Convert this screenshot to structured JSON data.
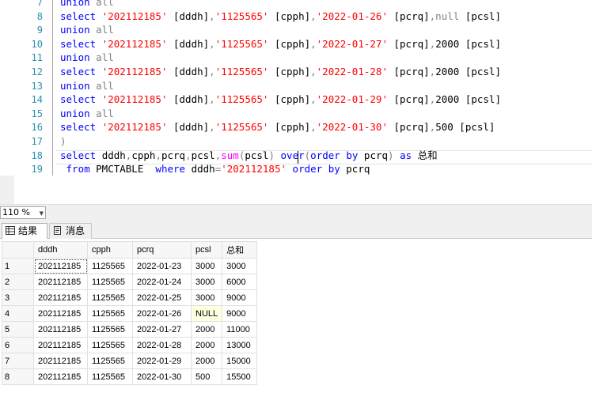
{
  "editor": {
    "lines": [
      {
        "num": "7",
        "tokens": [
          {
            "t": "union",
            "c": "kw"
          },
          {
            "t": " all",
            "c": "gr"
          }
        ]
      },
      {
        "num": "8",
        "tokens": [
          {
            "t": "select ",
            "c": "kw"
          },
          {
            "t": "'202112185'",
            "c": "str"
          },
          {
            "t": " [dddh]",
            "c": "tx"
          },
          {
            "t": ",",
            "c": "gr"
          },
          {
            "t": "'1125565'",
            "c": "str"
          },
          {
            "t": " [cpph]",
            "c": "tx"
          },
          {
            "t": ",",
            "c": "gr"
          },
          {
            "t": "'2022-01-26'",
            "c": "str"
          },
          {
            "t": " [pcrq]",
            "c": "tx"
          },
          {
            "t": ",null",
            "c": "gr"
          },
          {
            "t": " [pcsl]",
            "c": "tx"
          }
        ]
      },
      {
        "num": "9",
        "tokens": [
          {
            "t": "union",
            "c": "kw"
          },
          {
            "t": " all",
            "c": "gr"
          }
        ]
      },
      {
        "num": "10",
        "tokens": [
          {
            "t": "select ",
            "c": "kw"
          },
          {
            "t": "'202112185'",
            "c": "str"
          },
          {
            "t": " [dddh]",
            "c": "tx"
          },
          {
            "t": ",",
            "c": "gr"
          },
          {
            "t": "'1125565'",
            "c": "str"
          },
          {
            "t": " [cpph]",
            "c": "tx"
          },
          {
            "t": ",",
            "c": "gr"
          },
          {
            "t": "'2022-01-27'",
            "c": "str"
          },
          {
            "t": " [pcrq]",
            "c": "tx"
          },
          {
            "t": ",",
            "c": "gr"
          },
          {
            "t": "2000",
            "c": "tx"
          },
          {
            "t": " [pcsl]",
            "c": "tx"
          }
        ]
      },
      {
        "num": "11",
        "tokens": [
          {
            "t": "union",
            "c": "kw"
          },
          {
            "t": " all",
            "c": "gr"
          }
        ]
      },
      {
        "num": "12",
        "tokens": [
          {
            "t": "select ",
            "c": "kw"
          },
          {
            "t": "'202112185'",
            "c": "str"
          },
          {
            "t": " [dddh]",
            "c": "tx"
          },
          {
            "t": ",",
            "c": "gr"
          },
          {
            "t": "'1125565'",
            "c": "str"
          },
          {
            "t": " [cpph]",
            "c": "tx"
          },
          {
            "t": ",",
            "c": "gr"
          },
          {
            "t": "'2022-01-28'",
            "c": "str"
          },
          {
            "t": " [pcrq]",
            "c": "tx"
          },
          {
            "t": ",",
            "c": "gr"
          },
          {
            "t": "2000",
            "c": "tx"
          },
          {
            "t": " [pcsl]",
            "c": "tx"
          }
        ]
      },
      {
        "num": "13",
        "tokens": [
          {
            "t": "union",
            "c": "kw"
          },
          {
            "t": " all",
            "c": "gr"
          }
        ]
      },
      {
        "num": "14",
        "tokens": [
          {
            "t": "select ",
            "c": "kw"
          },
          {
            "t": "'202112185'",
            "c": "str"
          },
          {
            "t": " [dddh]",
            "c": "tx"
          },
          {
            "t": ",",
            "c": "gr"
          },
          {
            "t": "'1125565'",
            "c": "str"
          },
          {
            "t": " [cpph]",
            "c": "tx"
          },
          {
            "t": ",",
            "c": "gr"
          },
          {
            "t": "'2022-01-29'",
            "c": "str"
          },
          {
            "t": " [pcrq]",
            "c": "tx"
          },
          {
            "t": ",",
            "c": "gr"
          },
          {
            "t": "2000",
            "c": "tx"
          },
          {
            "t": " [pcsl]",
            "c": "tx"
          }
        ]
      },
      {
        "num": "15",
        "tokens": [
          {
            "t": "union",
            "c": "kw"
          },
          {
            "t": " all",
            "c": "gr"
          }
        ]
      },
      {
        "num": "16",
        "tokens": [
          {
            "t": "select ",
            "c": "kw"
          },
          {
            "t": "'202112185'",
            "c": "str"
          },
          {
            "t": " [dddh]",
            "c": "tx"
          },
          {
            "t": ",",
            "c": "gr"
          },
          {
            "t": "'1125565'",
            "c": "str"
          },
          {
            "t": " [cpph]",
            "c": "tx"
          },
          {
            "t": ",",
            "c": "gr"
          },
          {
            "t": "'2022-01-30'",
            "c": "str"
          },
          {
            "t": " [pcrq]",
            "c": "tx"
          },
          {
            "t": ",",
            "c": "gr"
          },
          {
            "t": "500",
            "c": "tx"
          },
          {
            "t": " [pcsl]",
            "c": "tx"
          }
        ]
      },
      {
        "num": "17",
        "tokens": [
          {
            "t": ")",
            "c": "gr"
          }
        ]
      },
      {
        "num": "18",
        "tokens": [
          {
            "t": "select ",
            "c": "kw"
          },
          {
            "t": "dddh",
            "c": "tx"
          },
          {
            "t": ",",
            "c": "gr"
          },
          {
            "t": "cpph",
            "c": "tx"
          },
          {
            "t": ",",
            "c": "gr"
          },
          {
            "t": "pcrq",
            "c": "tx"
          },
          {
            "t": ",",
            "c": "gr"
          },
          {
            "t": "pcsl",
            "c": "tx"
          },
          {
            "t": ",",
            "c": "gr"
          },
          {
            "t": "sum",
            "c": "fn"
          },
          {
            "t": "(",
            "c": "gr"
          },
          {
            "t": "pcsl",
            "c": "tx"
          },
          {
            "t": ")",
            "c": "gr"
          },
          {
            "t": " over",
            "c": "kw"
          },
          {
            "t": "(",
            "c": "gr"
          },
          {
            "t": "order by",
            "c": "kw"
          },
          {
            "t": " pcrq",
            "c": "tx"
          },
          {
            "t": ")",
            "c": "gr"
          },
          {
            "t": " as ",
            "c": "kw"
          },
          {
            "t": "总和",
            "c": "tx"
          }
        ]
      },
      {
        "num": "19",
        "tokens": [
          {
            "t": " from ",
            "c": "kw"
          },
          {
            "t": "PMCTABLE  ",
            "c": "tx"
          },
          {
            "t": "where ",
            "c": "kw"
          },
          {
            "t": "dddh",
            "c": "tx"
          },
          {
            "t": "=",
            "c": "gr"
          },
          {
            "t": "'202112185'",
            "c": "str"
          },
          {
            "t": " order by ",
            "c": "kw"
          },
          {
            "t": "pcrq",
            "c": "tx"
          }
        ]
      }
    ]
  },
  "zoom": {
    "value": "110 %"
  },
  "tabs": {
    "results_label": "结果",
    "messages_label": "消息"
  },
  "grid": {
    "columns": [
      "dddh",
      "cpph",
      "pcrq",
      "pcsl",
      "总和"
    ],
    "rows": [
      {
        "n": "1",
        "cells": [
          "202112185",
          "1125565",
          "2022-01-23",
          "3000",
          "3000"
        ]
      },
      {
        "n": "2",
        "cells": [
          "202112185",
          "1125565",
          "2022-01-24",
          "3000",
          "6000"
        ]
      },
      {
        "n": "3",
        "cells": [
          "202112185",
          "1125565",
          "2022-01-25",
          "3000",
          "9000"
        ]
      },
      {
        "n": "4",
        "cells": [
          "202112185",
          "1125565",
          "2022-01-26",
          "NULL",
          "9000"
        ]
      },
      {
        "n": "5",
        "cells": [
          "202112185",
          "1125565",
          "2022-01-27",
          "2000",
          "11000"
        ]
      },
      {
        "n": "6",
        "cells": [
          "202112185",
          "1125565",
          "2022-01-28",
          "2000",
          "13000"
        ]
      },
      {
        "n": "7",
        "cells": [
          "202112185",
          "1125565",
          "2022-01-29",
          "2000",
          "15000"
        ]
      },
      {
        "n": "8",
        "cells": [
          "202112185",
          "1125565",
          "2022-01-30",
          "500",
          "15500"
        ]
      }
    ]
  },
  "colors": {
    "keyword": "#0000ff",
    "string": "#ff0000",
    "operator": "#808080",
    "function": "#ff00ff",
    "line_number": "#2b91af",
    "null_cell": "#ffffe1"
  }
}
